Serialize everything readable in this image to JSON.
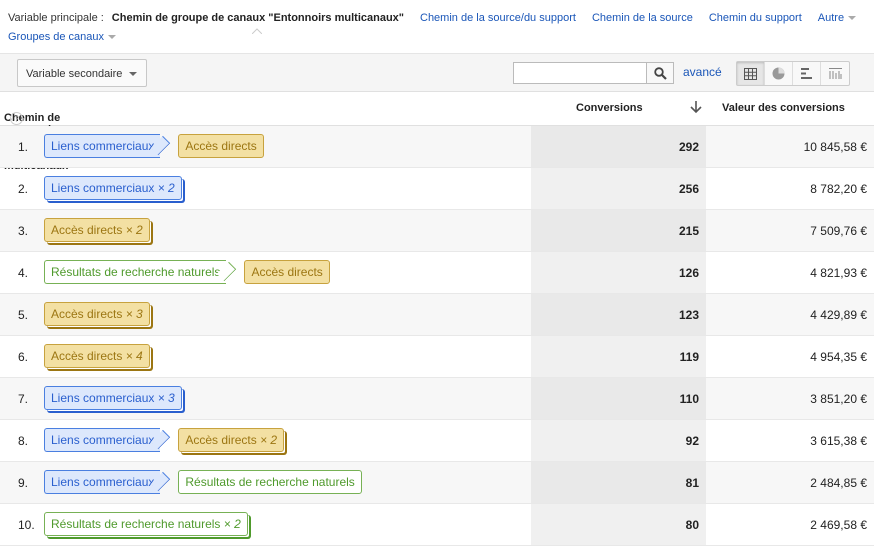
{
  "header": {
    "primary_label": "Variable principale :",
    "primary_current": "Chemin de groupe de canaux \"Entonnoirs multicanaux\"",
    "links": [
      "Chemin de la source/du support",
      "Chemin de la source",
      "Chemin du support"
    ],
    "other": "Autre",
    "groups": "Groupes de canaux"
  },
  "toolbar": {
    "secondary": "Variable secondaire",
    "search_value": "",
    "advanced": "avancé",
    "views": [
      "table-icon",
      "pie-icon",
      "bar-icon",
      "comparison-icon"
    ],
    "active_view": "table-icon"
  },
  "table": {
    "columns": [
      "Chemin de groupe de canaux \"Entonnoirs multicanaux\"",
      "Conversions",
      "Valeur des conversions"
    ],
    "help": "?",
    "sort_icon": "arrow-down-icon",
    "rows": [
      {
        "n": "1.",
        "path": [
          {
            "label": "Liens commerciaux",
            "mult": "",
            "type": "blue"
          },
          {
            "label": "Accès directs",
            "mult": "",
            "type": "yellow"
          }
        ],
        "conv": "292",
        "val": "10 845,58 €"
      },
      {
        "n": "2.",
        "path": [
          {
            "label": "Liens commerciaux",
            "mult": "× 2",
            "type": "blue"
          }
        ],
        "conv": "256",
        "val": "8 782,20 €"
      },
      {
        "n": "3.",
        "path": [
          {
            "label": "Accès directs",
            "mult": "× 2",
            "type": "yellow"
          }
        ],
        "conv": "215",
        "val": "7 509,76 €"
      },
      {
        "n": "4.",
        "path": [
          {
            "label": "Résultats de recherche naturels",
            "mult": "",
            "type": "green"
          },
          {
            "label": "Accès directs",
            "mult": "",
            "type": "yellow"
          }
        ],
        "conv": "126",
        "val": "4 821,93 €"
      },
      {
        "n": "5.",
        "path": [
          {
            "label": "Accès directs",
            "mult": "× 3",
            "type": "yellow"
          }
        ],
        "conv": "123",
        "val": "4 429,89 €"
      },
      {
        "n": "6.",
        "path": [
          {
            "label": "Accès directs",
            "mult": "× 4",
            "type": "yellow"
          }
        ],
        "conv": "119",
        "val": "4 954,35 €"
      },
      {
        "n": "7.",
        "path": [
          {
            "label": "Liens commerciaux",
            "mult": "× 3",
            "type": "blue"
          }
        ],
        "conv": "110",
        "val": "3 851,20 €"
      },
      {
        "n": "8.",
        "path": [
          {
            "label": "Liens commerciaux",
            "mult": "",
            "type": "blue"
          },
          {
            "label": "Accès directs",
            "mult": "× 2",
            "type": "yellow"
          }
        ],
        "conv": "92",
        "val": "3 615,38 €"
      },
      {
        "n": "9.",
        "path": [
          {
            "label": "Liens commerciaux",
            "mult": "",
            "type": "blue"
          },
          {
            "label": "Résultats de recherche naturels",
            "mult": "",
            "type": "green"
          }
        ],
        "conv": "81",
        "val": "2 484,85 €"
      },
      {
        "n": "10.",
        "path": [
          {
            "label": "Résultats de recherche naturels",
            "mult": "× 2",
            "type": "green"
          }
        ],
        "conv": "80",
        "val": "2 469,58 €"
      }
    ]
  }
}
